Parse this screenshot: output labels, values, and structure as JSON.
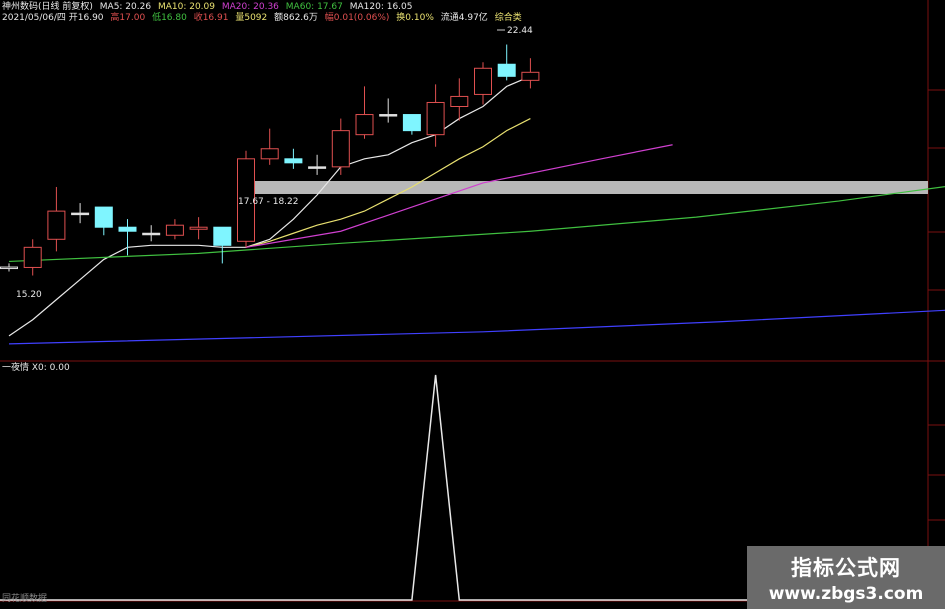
{
  "header": {
    "title": "神州数码(日线 前复权)",
    "ma5_label": "MA5: 20.26",
    "ma10_label": "MA10: 20.09",
    "ma20_label": "MA20: 20.36",
    "ma60_label": "MA60: 17.67",
    "ma120_label": "MA120: 16.05",
    "date_line": "2021/05/06/四 开16.90",
    "high_label": "高17.00",
    "low_label": "低16.80",
    "close_label": "收16.91",
    "volume_label": "量5092",
    "amount_label": "额862.6万",
    "change_label": "幅0.01(0.06%)",
    "turnover_label": "换0.10%",
    "float_label": "流通4.97亿",
    "sector_label": "综合类"
  },
  "indicator": {
    "title": "一夜情 X0: 0.00",
    "footer": "同花顺数据"
  },
  "watermark": {
    "line1": "指标公式网",
    "line2": "www.zbgs3.com"
  },
  "colors": {
    "up": "#e05050",
    "down": "#7ff5ff",
    "doji": "#e0e0e0",
    "ma5": "#e8e8e8",
    "ma10": "#e8e070",
    "ma20": "#d040d0",
    "ma60": "#40c040",
    "ma120": "#4040ff",
    "grid": "#7a1010"
  },
  "chart_data": {
    "type": "candlestick",
    "annotations": {
      "high": "22.44",
      "low": "15.20",
      "range": "17.67 - 18.22"
    },
    "candles": [
      {
        "o": 16.9,
        "h": 17.0,
        "l": 16.8,
        "c": 16.91
      },
      {
        "o": 16.9,
        "h": 17.6,
        "l": 16.7,
        "c": 17.4
      },
      {
        "o": 17.6,
        "h": 18.9,
        "l": 17.3,
        "c": 18.3
      },
      {
        "o": 18.25,
        "h": 18.5,
        "l": 18.0,
        "c": 18.25
      },
      {
        "o": 18.4,
        "h": 18.4,
        "l": 17.7,
        "c": 17.9
      },
      {
        "o": 17.9,
        "h": 18.1,
        "l": 17.2,
        "c": 17.8
      },
      {
        "o": 17.75,
        "h": 17.95,
        "l": 17.55,
        "c": 17.75
      },
      {
        "o": 17.7,
        "h": 18.1,
        "l": 17.6,
        "c": 17.95
      },
      {
        "o": 17.85,
        "h": 18.15,
        "l": 17.6,
        "c": 17.9
      },
      {
        "o": 17.9,
        "h": 17.9,
        "l": 17.0,
        "c": 17.45
      },
      {
        "o": 17.55,
        "h": 19.8,
        "l": 17.4,
        "c": 19.6
      },
      {
        "o": 19.6,
        "h": 20.35,
        "l": 19.45,
        "c": 19.85
      },
      {
        "o": 19.6,
        "h": 19.85,
        "l": 19.35,
        "c": 19.5
      },
      {
        "o": 19.4,
        "h": 19.7,
        "l": 19.2,
        "c": 19.4
      },
      {
        "o": 19.4,
        "h": 20.6,
        "l": 19.2,
        "c": 20.3
      },
      {
        "o": 20.2,
        "h": 21.4,
        "l": 20.1,
        "c": 20.7
      },
      {
        "o": 20.7,
        "h": 21.1,
        "l": 20.5,
        "c": 20.7
      },
      {
        "o": 20.7,
        "h": 20.7,
        "l": 20.2,
        "c": 20.3
      },
      {
        "o": 20.2,
        "h": 21.45,
        "l": 19.9,
        "c": 21.0
      },
      {
        "o": 20.9,
        "h": 21.6,
        "l": 20.55,
        "c": 21.15
      },
      {
        "o": 21.2,
        "h": 22.0,
        "l": 20.95,
        "c": 21.85
      },
      {
        "o": 21.95,
        "h": 22.44,
        "l": 21.55,
        "c": 21.65
      },
      {
        "o": 21.55,
        "h": 22.1,
        "l": 21.35,
        "c": 21.75
      }
    ],
    "price_ylim": [
      14.6,
      23.0
    ],
    "ma_series": [
      {
        "name": "MA5",
        "values": [
          15.2,
          15.6,
          16.1,
          16.6,
          17.1,
          17.4,
          17.45,
          17.45,
          17.45,
          17.4,
          17.4,
          17.6,
          18.1,
          18.7,
          19.4,
          19.6,
          19.7,
          20.0,
          20.2,
          20.6,
          20.9,
          21.4,
          21.65
        ]
      },
      {
        "name": "MA10",
        "values": [
          null,
          null,
          null,
          null,
          null,
          null,
          null,
          null,
          null,
          null,
          17.4,
          17.55,
          17.75,
          17.95,
          18.1,
          18.3,
          18.6,
          18.9,
          19.25,
          19.6,
          19.9,
          20.3,
          20.6
        ]
      },
      {
        "name": "MA20",
        "values": [
          {
            "i": 10,
            "v": 17.4
          },
          {
            "i": 14,
            "v": 17.8
          },
          {
            "i": 17,
            "v": 18.4
          },
          {
            "i": 20,
            "v": 19.0
          },
          {
            "i": 25,
            "v": 19.6
          },
          {
            "i": 28,
            "v": 19.95
          }
        ]
      },
      {
        "name": "MA60",
        "values": [
          {
            "i": 0,
            "v": 17.05
          },
          {
            "i": 8,
            "v": 17.25
          },
          {
            "i": 14,
            "v": 17.5
          },
          {
            "i": 22,
            "v": 17.8
          },
          {
            "i": 29,
            "v": 18.15
          },
          {
            "i": 35,
            "v": 18.55
          },
          {
            "i": 40,
            "v": 18.95
          }
        ]
      },
      {
        "name": "MA120",
        "values": [
          {
            "i": 0,
            "v": 15.0
          },
          {
            "i": 10,
            "v": 15.15
          },
          {
            "i": 20,
            "v": 15.3
          },
          {
            "i": 30,
            "v": 15.55
          },
          {
            "i": 40,
            "v": 15.85
          }
        ]
      }
    ],
    "signal": {
      "name": "X0",
      "values": [
        0,
        0,
        0,
        0,
        0,
        0,
        0,
        0,
        0,
        0,
        0,
        0,
        0,
        0,
        0,
        0,
        0,
        0,
        1,
        0,
        0,
        0,
        0
      ],
      "ylim": [
        0,
        1
      ]
    }
  }
}
